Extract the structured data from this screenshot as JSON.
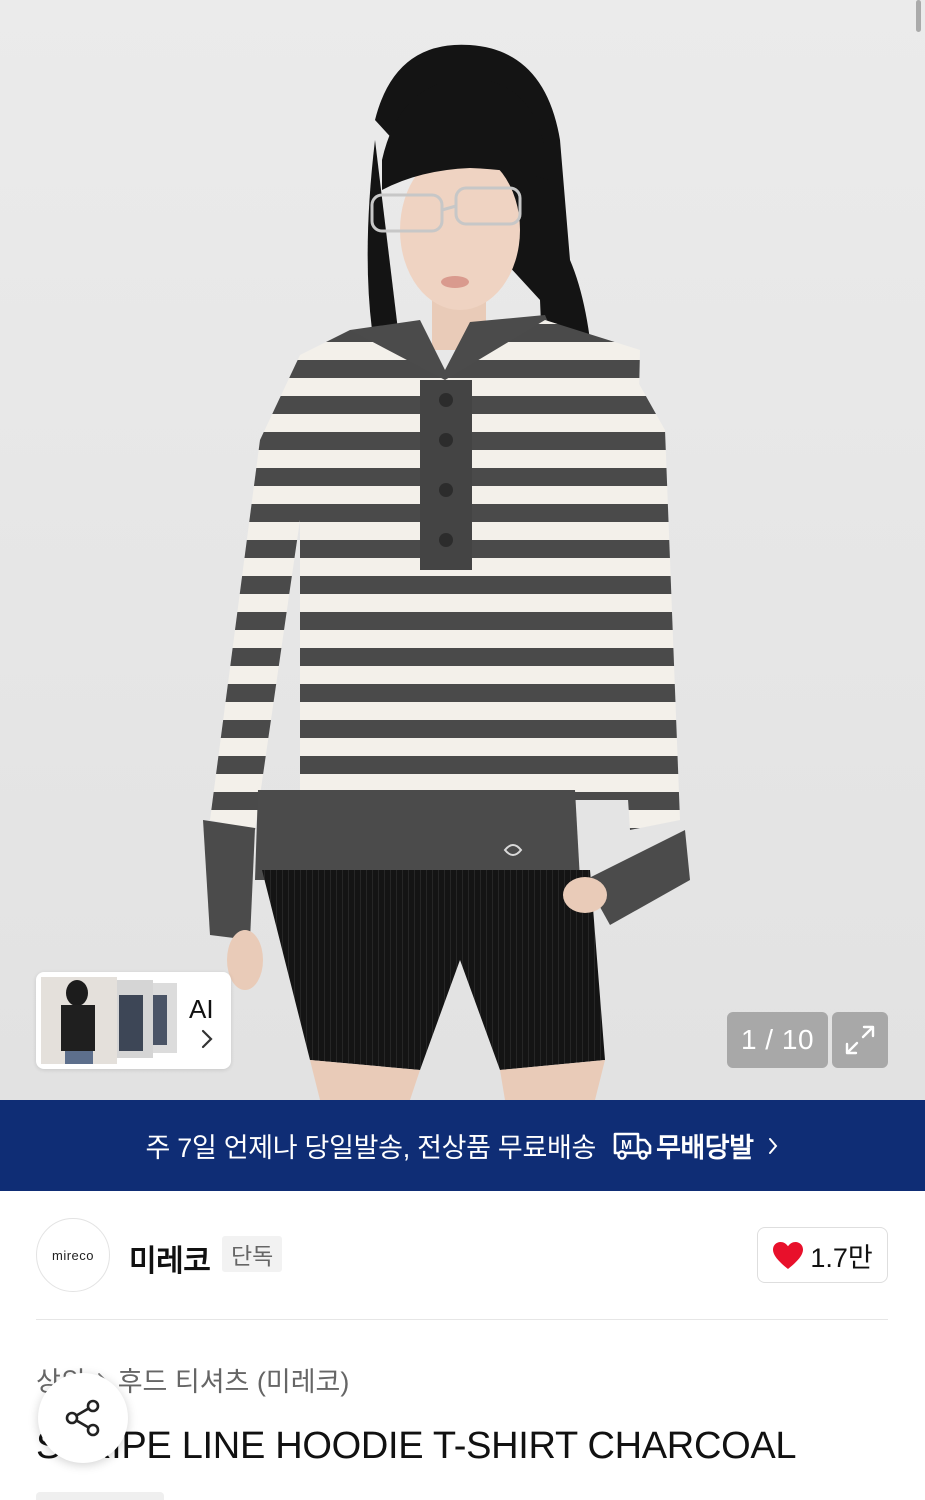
{
  "hero": {
    "image_alt": "",
    "counter_current": "1",
    "counter_separator": " / ",
    "counter_total": "10",
    "ai_label": "AI"
  },
  "banner": {
    "promo_text": "주 7일 언제나 당일발송, 전상품 무료배송",
    "service_name": "무배당발",
    "service_logo_letter": "M",
    "bg_color": "#0f2d75"
  },
  "brand": {
    "logo_text": "mireco",
    "name": "미레코",
    "badge": "단독",
    "like_count": "1.7만",
    "heart_color": "#e8102b"
  },
  "breadcrumb": {
    "category": "상의",
    "subcategory": "후드 티셔츠 (미레코)"
  },
  "product": {
    "title": "STRIPE LINE HOODIE T-SHIRT CHARCOAL"
  }
}
